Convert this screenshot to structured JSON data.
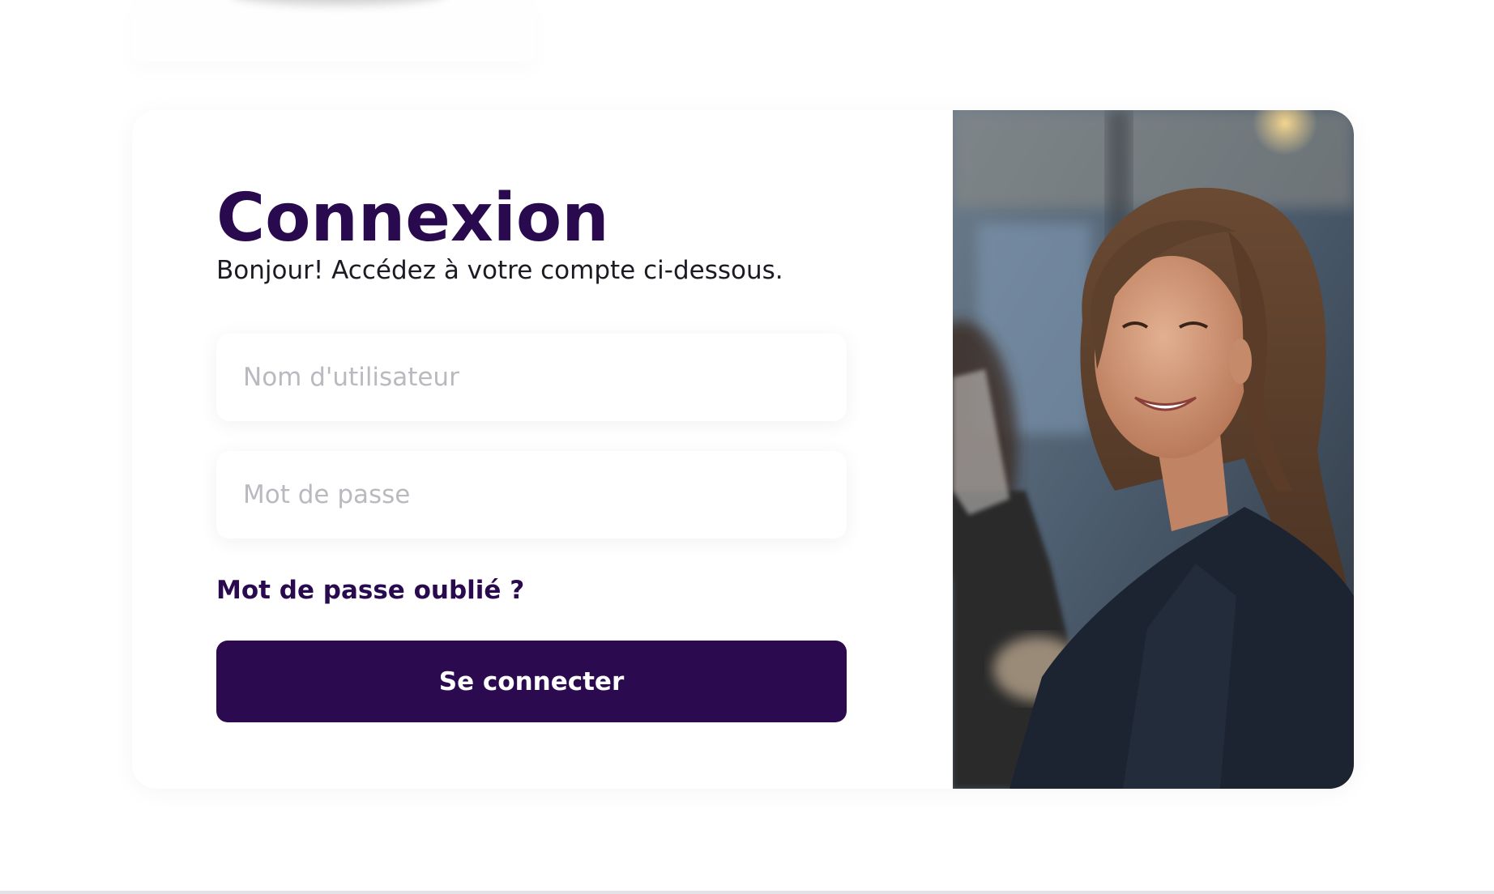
{
  "login": {
    "title": "Connexion",
    "subtitle": "Bonjour! Accédez à votre compte ci-dessous.",
    "username_placeholder": "Nom d'utilisateur",
    "username_value": "",
    "password_placeholder": "Mot de passe",
    "password_value": "",
    "forgot_label": "Mot de passe oublié ?",
    "submit_label": "Se connecter"
  },
  "colors": {
    "brand": "#2b0a4f",
    "text": "#1b1b24",
    "placeholder": "#b9b9bf",
    "background": "#ffffff"
  },
  "icons": {
    "logo": "logo-pill"
  }
}
